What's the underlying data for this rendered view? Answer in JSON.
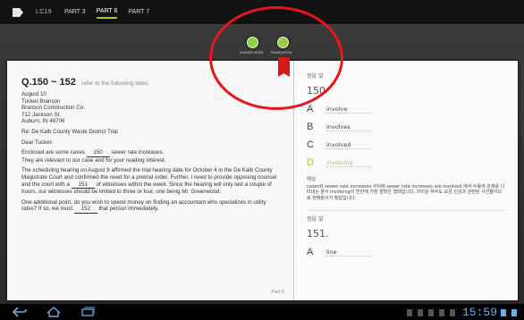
{
  "topbar": {
    "app_icon": "tag-icon",
    "label": "LC19",
    "tabs": [
      {
        "label": "PART 3"
      },
      {
        "label": "PART 6"
      },
      {
        "label": "PART 7"
      }
    ]
  },
  "dots": [
    {
      "caption": "ANSWER MODE"
    },
    {
      "caption": "TRANSLATION"
    }
  ],
  "document": {
    "title": "Q.150 ~ 152",
    "refer": "refer to the following letter.",
    "address_lines": [
      "August 10",
      "Tucker Branson",
      "Branson Construction Co.",
      "712 Jackson St.",
      "Auburn, IN 46706"
    ],
    "re_line": "Re: De Kalb County Waste District Trial",
    "salutation": "Dear Tucker:",
    "p1_before": "Enclosed are some cases",
    "p1_blank": "150",
    "p1_after": "sewer rate increases.",
    "p1_line2": "They are relevant to our case and for your reading interest.",
    "p2_part1": "The scheduling hearing on August 9 affirmed the trial hearing date for October 4 in the De Kalb County Magistrate Court and confirmed the need for a pretrial order. Further, I need to provide opposing counsel and the court with a",
    "p2_blank": "151",
    "p2_part2": "of witnesses within the week. Since the hearing will only last a couple of hours, our witnesses should be limited to three or four, one being Mr. Greenwood.",
    "p3_part1": "One additional point, do you wish to spend money on finding an accountant who specializes in utility rates? If so, we must",
    "p3_blank": "152",
    "p3_part2": "that person immediately.",
    "page": "Part 6"
  },
  "answer_panel": {
    "header": "정답 및",
    "question_number": "150",
    "options": [
      {
        "letter": "A",
        "word": "involve",
        "correct": false
      },
      {
        "letter": "B",
        "word": "involves",
        "correct": false
      },
      {
        "letter": "C",
        "word": "involved",
        "correct": false
      },
      {
        "letter": "D",
        "word": "involving",
        "correct": true
      }
    ],
    "explanation_head": "해설",
    "explanation": "cases와 sewer rate increases 사이에 sewer rate increases are involved 에서 수동태 관계를 나타내는 분사 involving이 빈칸에 가장 알맞은 형태입니다. 의미상 하수도 요금 인상과 관련된 사건들이므로 현재분사가 정답입니다.",
    "next_header": "정답 및",
    "next_number": "151.",
    "next_option": {
      "letter": "A",
      "word": "line"
    }
  },
  "sysbar": {
    "icons": [
      "back-icon",
      "home-icon",
      "recent-apps-icon"
    ],
    "clock": "15:59"
  }
}
